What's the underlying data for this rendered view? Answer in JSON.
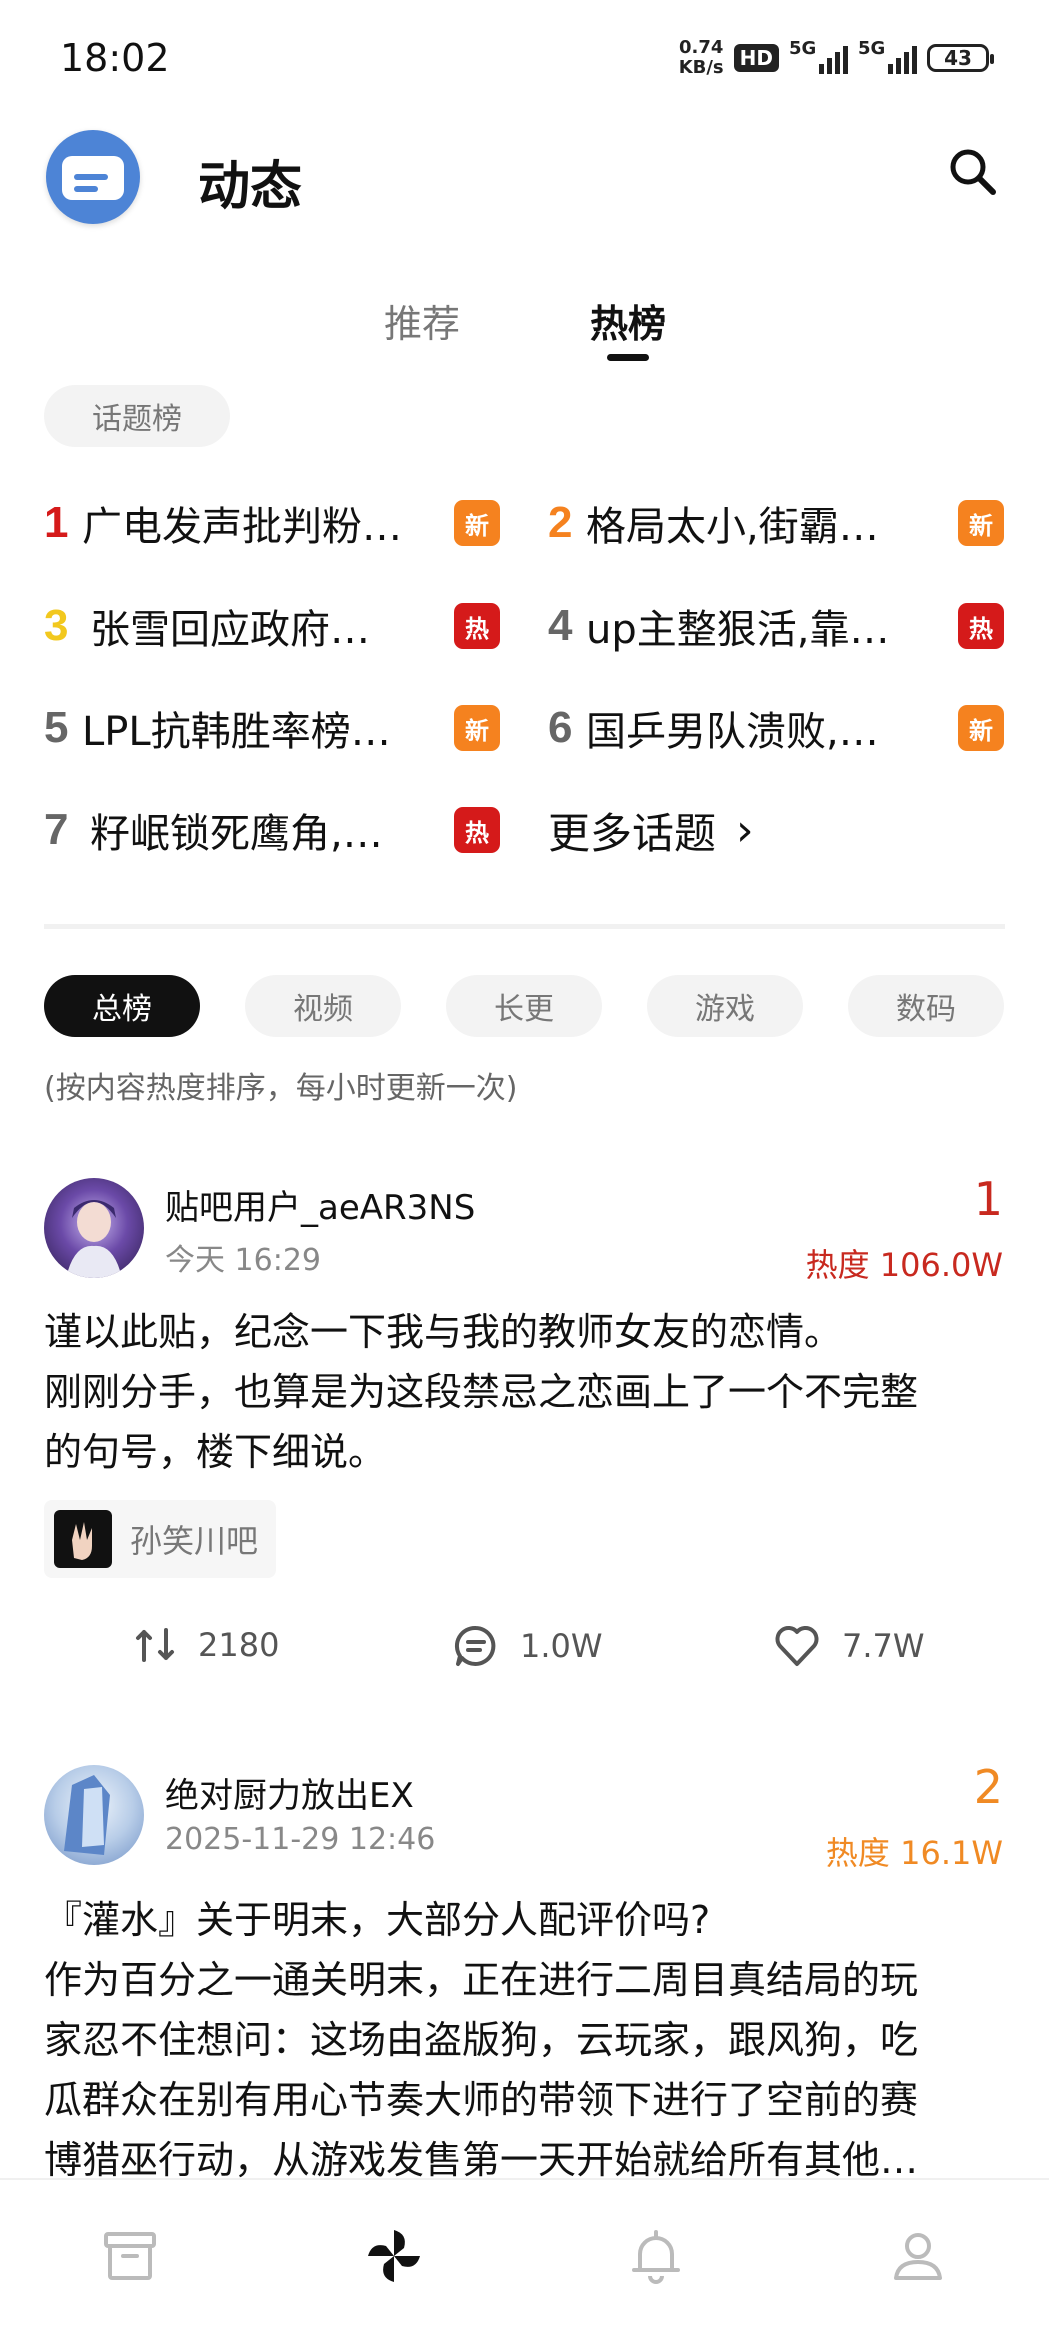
{
  "status_bar": {
    "time": "18:02",
    "speed_value": "0.74",
    "speed_unit": "KB/s",
    "hd_label": "HD",
    "net1": "5G",
    "net2": "5G",
    "battery": "43"
  },
  "header": {
    "title": "动态",
    "avatar_icon": "app-logo-icon",
    "search_icon": "search-icon"
  },
  "tabs": [
    {
      "label": "推荐",
      "active": false
    },
    {
      "label": "热榜",
      "active": true
    }
  ],
  "topic_chip": "话题榜",
  "hot_topics": [
    {
      "rank": "1",
      "text": "广电发声批判粉…",
      "badge": "新",
      "badge_type": "new",
      "rank_color": "#d51a1a"
    },
    {
      "rank": "2",
      "text": "格局太小,街霸…",
      "badge": "新",
      "badge_type": "new",
      "rank_color": "#f5821f"
    },
    {
      "rank": "3",
      "text": "张雪回应政府…",
      "badge": "热",
      "badge_type": "hot",
      "rank_color": "#f2c81e"
    },
    {
      "rank": "4",
      "text": "up主整狠活,靠…",
      "badge": "热",
      "badge_type": "hot",
      "rank_color": "#666666"
    },
    {
      "rank": "5",
      "text": "LPL抗韩胜率榜…",
      "badge": "新",
      "badge_type": "new",
      "rank_color": "#666666"
    },
    {
      "rank": "6",
      "text": "国乒男队溃败,…",
      "badge": "新",
      "badge_type": "new",
      "rank_color": "#666666"
    },
    {
      "rank": "7",
      "text": "籽岷锁死鹰角,…",
      "badge": "热",
      "badge_type": "hot",
      "rank_color": "#666666"
    }
  ],
  "more_topics": {
    "label": "更多话题",
    "chevron": "›"
  },
  "categories": [
    {
      "label": "总榜",
      "active": true
    },
    {
      "label": "视频",
      "active": false
    },
    {
      "label": "长更",
      "active": false
    },
    {
      "label": "游戏",
      "active": false
    },
    {
      "label": "数码",
      "active": false
    }
  ],
  "sort_note": "(按内容热度排序，每小时更新一次)",
  "posts": [
    {
      "user": "贴吧用户_aeAR3NS",
      "time": "今天 16:29",
      "rank": "1",
      "heat": "热度 106.0W",
      "rank_color": "#c8291f",
      "lines": [
        "谨以此贴，纪念一下我与我的教师女友的恋情。",
        "刚刚分手，也算是为这段禁忌之恋画上了一个不完整",
        "的句号，楼下细说。"
      ],
      "forum": "孙笑川吧",
      "reposts": "2180",
      "comments": "1.0W",
      "likes": "7.7W"
    },
    {
      "user": "绝对厨力放出EX",
      "time": "2025-11-29 12:46",
      "rank": "2",
      "heat": "热度 16.1W",
      "rank_color": "#f08a24",
      "lines": [
        "『灌水』关于明末，大部分人配评价吗?",
        "作为百分之一通关明末，正在进行二周目真结局的玩",
        "家忍不住想问：这场由盗版狗，云玩家，跟风狗，吃",
        "瓜群众在别有用心节奏大师的带领下进行了空前的赛",
        "博猎巫行动，从游戏发售第一天开始就给所有其他…"
      ]
    }
  ],
  "bottom_nav": [
    {
      "icon": "archive-icon",
      "active": false
    },
    {
      "icon": "pinwheel-icon",
      "active": true
    },
    {
      "icon": "bell-icon",
      "active": false
    },
    {
      "icon": "profile-icon",
      "active": false
    }
  ]
}
